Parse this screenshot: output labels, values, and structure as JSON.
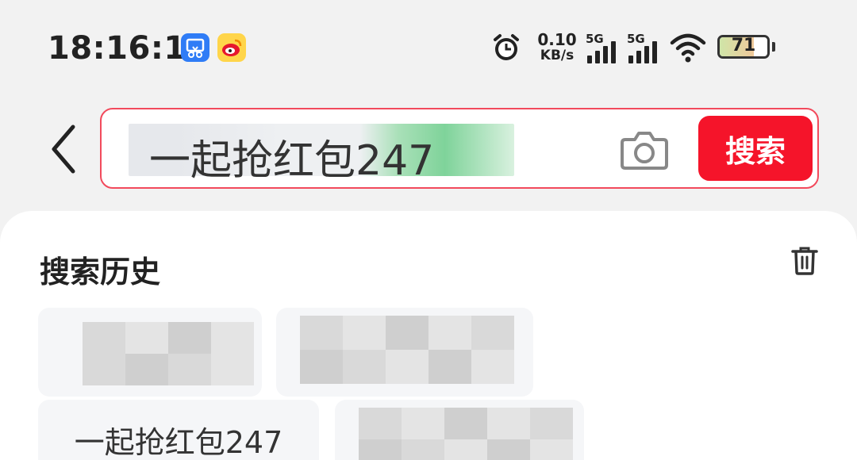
{
  "status_bar": {
    "time": "18:16:12",
    "net_speed_value": "0.10",
    "net_speed_unit": "KB/s",
    "sim1_label": "5G",
    "sim2_label": "5G",
    "battery_level": "71",
    "battery_fraction": 0.71,
    "icons": [
      "scissor-app-icon",
      "weibo-icon",
      "alarm-icon",
      "signal-icon",
      "signal-icon",
      "wifi-icon",
      "battery-icon"
    ]
  },
  "search": {
    "query": "一起抢红包247",
    "button_label": "搜索",
    "accent_color": "#f5142a",
    "border_color": "#f24a5c"
  },
  "history": {
    "title": "搜索历史",
    "items": [
      "",
      "",
      "一起抢红包247",
      ""
    ]
  }
}
